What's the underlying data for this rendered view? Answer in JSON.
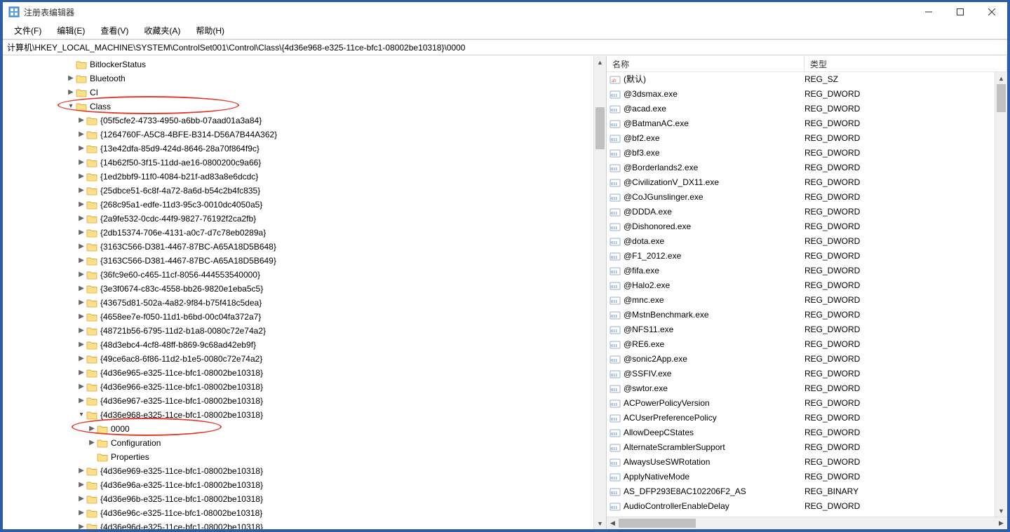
{
  "window": {
    "title": "注册表编辑器"
  },
  "menu": {
    "file": "文件(F)",
    "edit": "编辑(E)",
    "view": "查看(V)",
    "favorites": "收藏夹(A)",
    "help": "帮助(H)"
  },
  "address": "计算机\\HKEY_LOCAL_MACHINE\\SYSTEM\\ControlSet001\\Control\\Class\\{4d36e968-e325-11ce-bfc1-08002be10318}\\0000",
  "tree": [
    {
      "indent": 6,
      "arrow": "",
      "label": "BitlockerStatus"
    },
    {
      "indent": 6,
      "arrow": "closed",
      "label": "Bluetooth"
    },
    {
      "indent": 6,
      "arrow": "closed",
      "label": "CI"
    },
    {
      "indent": 6,
      "arrow": "open",
      "label": "Class"
    },
    {
      "indent": 7,
      "arrow": "closed",
      "label": "{05f5cfe2-4733-4950-a6bb-07aad01a3a84}"
    },
    {
      "indent": 7,
      "arrow": "closed",
      "label": "{1264760F-A5C8-4BFE-B314-D56A7B44A362}"
    },
    {
      "indent": 7,
      "arrow": "closed",
      "label": "{13e42dfa-85d9-424d-8646-28a70f864f9c}"
    },
    {
      "indent": 7,
      "arrow": "closed",
      "label": "{14b62f50-3f15-11dd-ae16-0800200c9a66}"
    },
    {
      "indent": 7,
      "arrow": "closed",
      "label": "{1ed2bbf9-11f0-4084-b21f-ad83a8e6dcdc}"
    },
    {
      "indent": 7,
      "arrow": "closed",
      "label": "{25dbce51-6c8f-4a72-8a6d-b54c2b4fc835}"
    },
    {
      "indent": 7,
      "arrow": "closed",
      "label": "{268c95a1-edfe-11d3-95c3-0010dc4050a5}"
    },
    {
      "indent": 7,
      "arrow": "closed",
      "label": "{2a9fe532-0cdc-44f9-9827-76192f2ca2fb}"
    },
    {
      "indent": 7,
      "arrow": "closed",
      "label": "{2db15374-706e-4131-a0c7-d7c78eb0289a}"
    },
    {
      "indent": 7,
      "arrow": "closed",
      "label": "{3163C566-D381-4467-87BC-A65A18D5B648}"
    },
    {
      "indent": 7,
      "arrow": "closed",
      "label": "{3163C566-D381-4467-87BC-A65A18D5B649}"
    },
    {
      "indent": 7,
      "arrow": "closed",
      "label": "{36fc9e60-c465-11cf-8056-444553540000}"
    },
    {
      "indent": 7,
      "arrow": "closed",
      "label": "{3e3f0674-c83c-4558-bb26-9820e1eba5c5}"
    },
    {
      "indent": 7,
      "arrow": "closed",
      "label": "{43675d81-502a-4a82-9f84-b75f418c5dea}"
    },
    {
      "indent": 7,
      "arrow": "closed",
      "label": "{4658ee7e-f050-11d1-b6bd-00c04fa372a7}"
    },
    {
      "indent": 7,
      "arrow": "closed",
      "label": "{48721b56-6795-11d2-b1a8-0080c72e74a2}"
    },
    {
      "indent": 7,
      "arrow": "closed",
      "label": "{48d3ebc4-4cf8-48ff-b869-9c68ad42eb9f}"
    },
    {
      "indent": 7,
      "arrow": "closed",
      "label": "{49ce6ac8-6f86-11d2-b1e5-0080c72e74a2}"
    },
    {
      "indent": 7,
      "arrow": "closed",
      "label": "{4d36e965-e325-11ce-bfc1-08002be10318}"
    },
    {
      "indent": 7,
      "arrow": "closed",
      "label": "{4d36e966-e325-11ce-bfc1-08002be10318}"
    },
    {
      "indent": 7,
      "arrow": "closed",
      "label": "{4d36e967-e325-11ce-bfc1-08002be10318}"
    },
    {
      "indent": 7,
      "arrow": "open",
      "label": "{4d36e968-e325-11ce-bfc1-08002be10318}"
    },
    {
      "indent": 8,
      "arrow": "closed",
      "label": "0000"
    },
    {
      "indent": 8,
      "arrow": "closed",
      "label": "Configuration"
    },
    {
      "indent": 8,
      "arrow": "",
      "label": "Properties"
    },
    {
      "indent": 7,
      "arrow": "closed",
      "label": "{4d36e969-e325-11ce-bfc1-08002be10318}"
    },
    {
      "indent": 7,
      "arrow": "closed",
      "label": "{4d36e96a-e325-11ce-bfc1-08002be10318}"
    },
    {
      "indent": 7,
      "arrow": "closed",
      "label": "{4d36e96b-e325-11ce-bfc1-08002be10318}"
    },
    {
      "indent": 7,
      "arrow": "closed",
      "label": "{4d36e96c-e325-11ce-bfc1-08002be10318}"
    },
    {
      "indent": 7,
      "arrow": "closed",
      "label": "{4d36e96d-e325-11ce-bfc1-08002be10318}"
    }
  ],
  "list": {
    "columns": {
      "name": "名称",
      "type": "类型"
    },
    "rows": [
      {
        "icon": "str",
        "name": "(默认)",
        "type": "REG_SZ"
      },
      {
        "icon": "dw",
        "name": "@3dsmax.exe",
        "type": "REG_DWORD"
      },
      {
        "icon": "dw",
        "name": "@acad.exe",
        "type": "REG_DWORD"
      },
      {
        "icon": "dw",
        "name": "@BatmanAC.exe",
        "type": "REG_DWORD"
      },
      {
        "icon": "dw",
        "name": "@bf2.exe",
        "type": "REG_DWORD"
      },
      {
        "icon": "dw",
        "name": "@bf3.exe",
        "type": "REG_DWORD"
      },
      {
        "icon": "dw",
        "name": "@Borderlands2.exe",
        "type": "REG_DWORD"
      },
      {
        "icon": "dw",
        "name": "@CivilizationV_DX11.exe",
        "type": "REG_DWORD"
      },
      {
        "icon": "dw",
        "name": "@CoJGunslinger.exe",
        "type": "REG_DWORD"
      },
      {
        "icon": "dw",
        "name": "@DDDA.exe",
        "type": "REG_DWORD"
      },
      {
        "icon": "dw",
        "name": "@Dishonored.exe",
        "type": "REG_DWORD"
      },
      {
        "icon": "dw",
        "name": "@dota.exe",
        "type": "REG_DWORD"
      },
      {
        "icon": "dw",
        "name": "@F1_2012.exe",
        "type": "REG_DWORD"
      },
      {
        "icon": "dw",
        "name": "@fifa.exe",
        "type": "REG_DWORD"
      },
      {
        "icon": "dw",
        "name": "@Halo2.exe",
        "type": "REG_DWORD"
      },
      {
        "icon": "dw",
        "name": "@mnc.exe",
        "type": "REG_DWORD"
      },
      {
        "icon": "dw",
        "name": "@MstnBenchmark.exe",
        "type": "REG_DWORD"
      },
      {
        "icon": "dw",
        "name": "@NFS11.exe",
        "type": "REG_DWORD"
      },
      {
        "icon": "dw",
        "name": "@RE6.exe",
        "type": "REG_DWORD"
      },
      {
        "icon": "dw",
        "name": "@sonic2App.exe",
        "type": "REG_DWORD"
      },
      {
        "icon": "dw",
        "name": "@SSFIV.exe",
        "type": "REG_DWORD"
      },
      {
        "icon": "dw",
        "name": "@swtor.exe",
        "type": "REG_DWORD"
      },
      {
        "icon": "dw",
        "name": "ACPowerPolicyVersion",
        "type": "REG_DWORD"
      },
      {
        "icon": "dw",
        "name": "ACUserPreferencePolicy",
        "type": "REG_DWORD"
      },
      {
        "icon": "dw",
        "name": "AllowDeepCStates",
        "type": "REG_DWORD"
      },
      {
        "icon": "dw",
        "name": "AlternateScramblerSupport",
        "type": "REG_DWORD"
      },
      {
        "icon": "dw",
        "name": "AlwaysUseSWRotation",
        "type": "REG_DWORD"
      },
      {
        "icon": "dw",
        "name": "ApplyNativeMode",
        "type": "REG_DWORD"
      },
      {
        "icon": "dw",
        "name": "AS_DFP293E8AC102206F2_AS",
        "type": "REG_BINARY"
      },
      {
        "icon": "dw",
        "name": "AudioControllerEnableDelay",
        "type": "REG_DWORD"
      }
    ]
  }
}
